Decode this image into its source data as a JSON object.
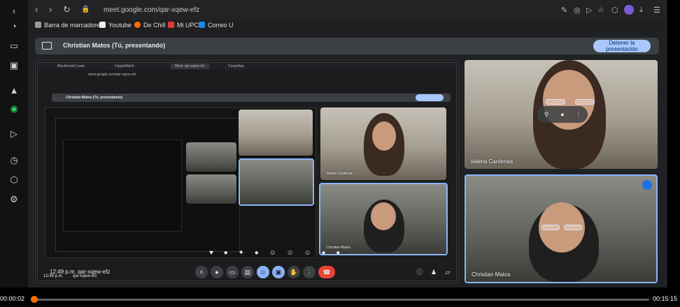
{
  "browser": {
    "url": "meet.google.com/qar-xqew-efz",
    "bookmarks": [
      {
        "label": "Barra de marcadore..."
      },
      {
        "label": "Youtube"
      },
      {
        "label": "De Chill"
      },
      {
        "label": "Mi UPC"
      },
      {
        "label": "Correo U"
      }
    ]
  },
  "presenting": {
    "label": "Christian Matos (Tú, presentando)",
    "stop_button": "Detener la presentación"
  },
  "inner_screen": {
    "tabs": [
      "Blackboard Learn",
      "CargoWatch",
      "Meet: qar-xqew-efz",
      "CargoApp"
    ],
    "url": "meet.google.com/qar-xqew-efz",
    "presenting_label": "Christian Matos (Tú, presentando)",
    "stop_button": "Detener la presentación",
    "time": "12:49 p.m.",
    "meeting_code": "qar-xqew-efz",
    "tile_name_1": "Valeria Cardenas",
    "tile_name_2": "Christian Matos"
  },
  "participants": [
    {
      "name": "Valeria Cardenas"
    },
    {
      "name": "Christian Matos"
    }
  ],
  "player": {
    "current": "00:00:02",
    "total": "00:15:15",
    "progress": 0.002
  },
  "colors": {
    "accent": "#a8c7fa",
    "end_call": "#ea4335",
    "progress": "#ff6d00"
  }
}
